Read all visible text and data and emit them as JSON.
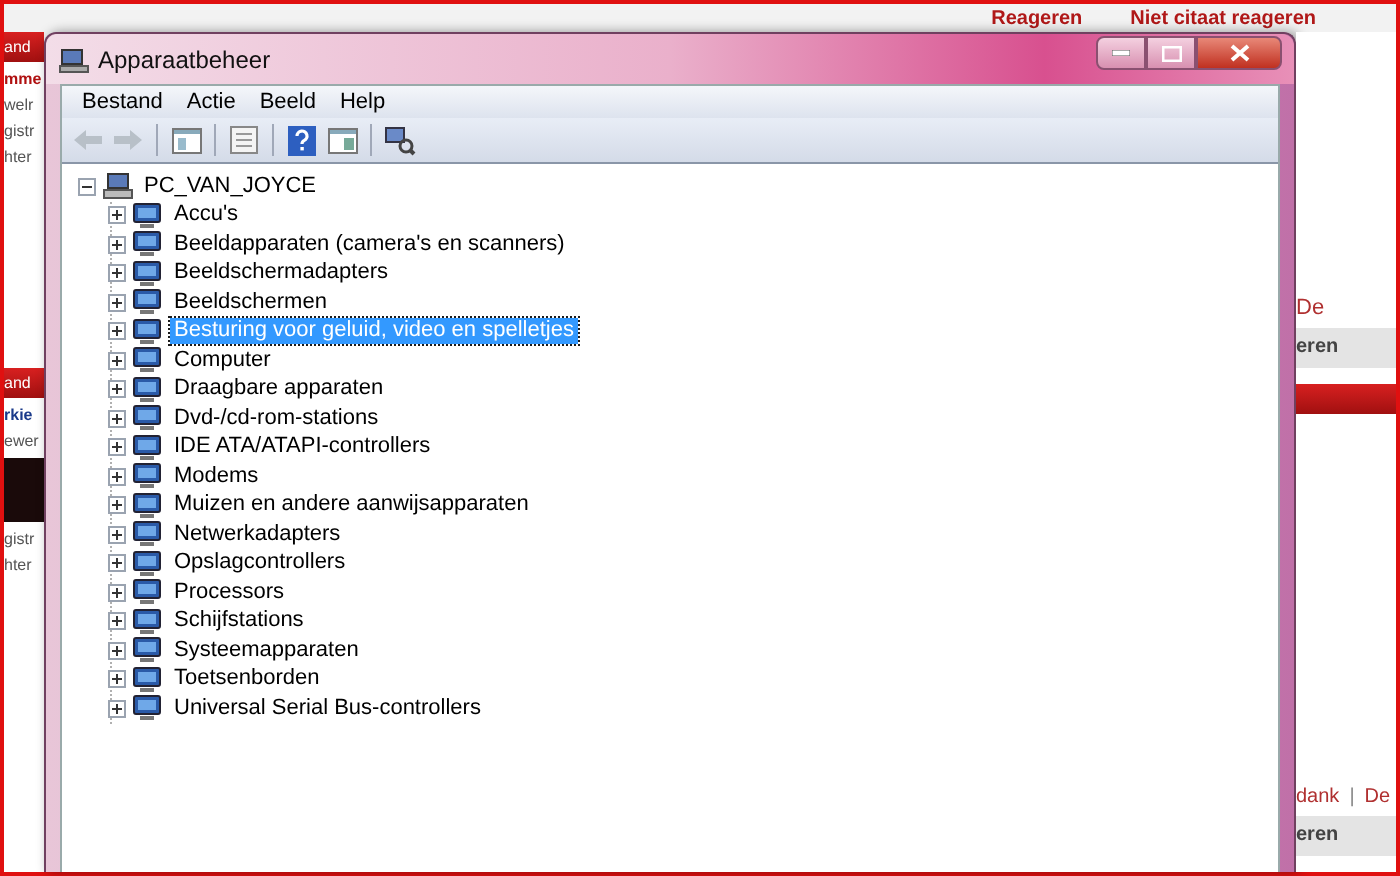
{
  "background_page": {
    "top_links": [
      "Reageren",
      "Niet citaat reageren"
    ],
    "left_blocks": [
      [
        {
          "kind": "bar",
          "text": "and"
        },
        {
          "kind": "heading",
          "text": "mme"
        },
        {
          "kind": "text",
          "text": "welr"
        },
        {
          "kind": "text",
          "text": "gistr"
        },
        {
          "kind": "text",
          "text": "hter"
        }
      ],
      [
        {
          "kind": "bar",
          "text": "and"
        },
        {
          "kind": "link",
          "text": "rkie"
        },
        {
          "kind": "text",
          "text": "ewer"
        },
        {
          "kind": "photo"
        },
        {
          "kind": "text",
          "text": "gistr"
        },
        {
          "kind": "text",
          "text": "hter"
        }
      ]
    ],
    "right_blocks": [
      [
        {
          "kind": "link",
          "text": "De"
        },
        {
          "kind": "toolbar",
          "text": "eren"
        }
      ],
      [
        {
          "kind": "bar"
        },
        {
          "kind": "linkrow",
          "texts": [
            "dank",
            "|",
            "De"
          ]
        },
        {
          "kind": "toolbar",
          "text": "eren"
        }
      ]
    ]
  },
  "window": {
    "title": "Apparaatbeheer"
  },
  "menu": [
    "Bestand",
    "Actie",
    "Beeld",
    "Help"
  ],
  "tree": {
    "label": "PC_VAN_JOYCE",
    "expanded": true,
    "selected": false,
    "children": [
      {
        "label": "Accu's",
        "expanded": false,
        "selected": false
      },
      {
        "label": "Beeldapparaten (camera's en scanners)",
        "expanded": false,
        "selected": false
      },
      {
        "label": "Beeldschermadapters",
        "expanded": false,
        "selected": false
      },
      {
        "label": "Beeldschermen",
        "expanded": false,
        "selected": false
      },
      {
        "label": "Besturing voor geluid, video en spelletjes",
        "expanded": false,
        "selected": true
      },
      {
        "label": "Computer",
        "expanded": false,
        "selected": false
      },
      {
        "label": "Draagbare apparaten",
        "expanded": false,
        "selected": false
      },
      {
        "label": "Dvd-/cd-rom-stations",
        "expanded": false,
        "selected": false
      },
      {
        "label": "IDE ATA/ATAPI-controllers",
        "expanded": false,
        "selected": false
      },
      {
        "label": "Modems",
        "expanded": false,
        "selected": false
      },
      {
        "label": "Muizen en andere aanwijsapparaten",
        "expanded": false,
        "selected": false
      },
      {
        "label": "Netwerkadapters",
        "expanded": false,
        "selected": false
      },
      {
        "label": "Opslagcontrollers",
        "expanded": false,
        "selected": false
      },
      {
        "label": "Processors",
        "expanded": false,
        "selected": false
      },
      {
        "label": "Schijfstations",
        "expanded": false,
        "selected": false
      },
      {
        "label": "Systeemapparaten",
        "expanded": false,
        "selected": false
      },
      {
        "label": "Toetsenborden",
        "expanded": false,
        "selected": false
      },
      {
        "label": "Universal Serial Bus-controllers",
        "expanded": false,
        "selected": false
      }
    ]
  }
}
